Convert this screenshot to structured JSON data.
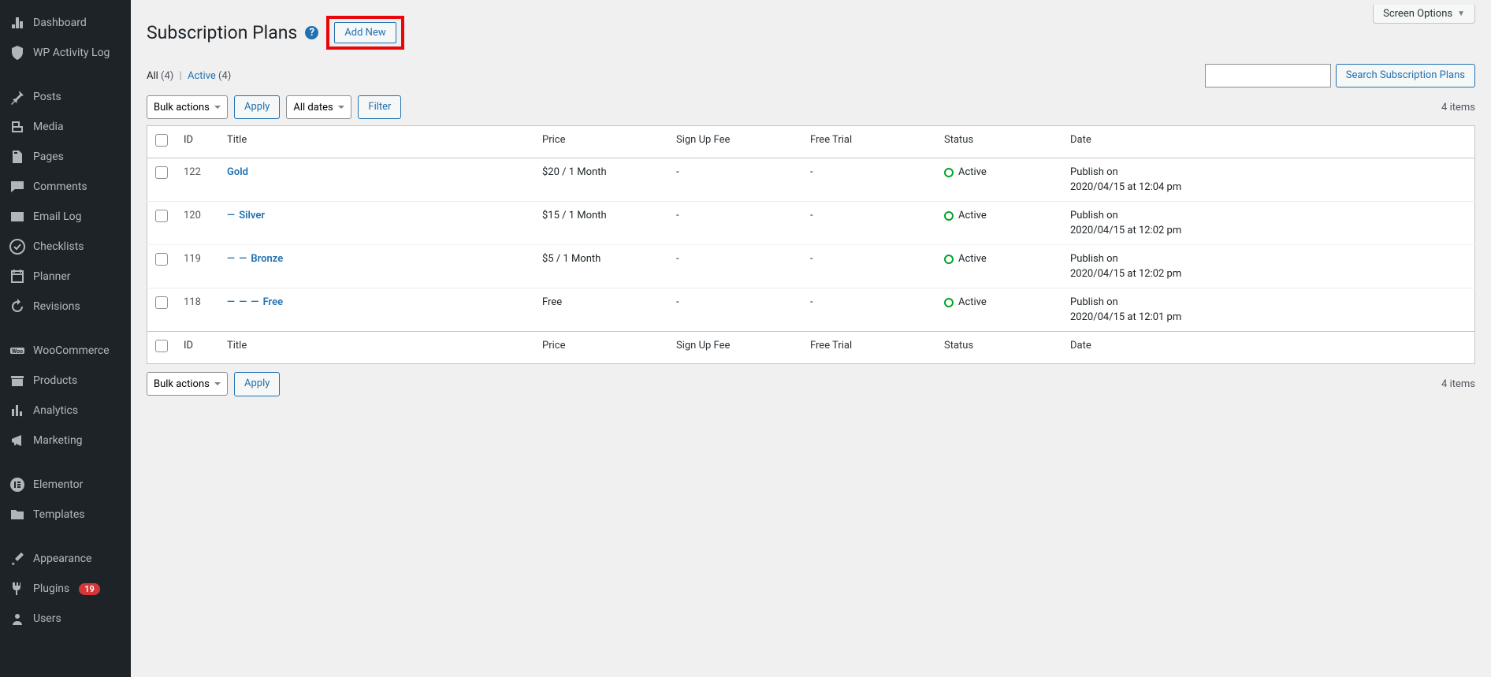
{
  "sidebar": {
    "items": [
      {
        "icon": "dashboard",
        "label": "Dashboard"
      },
      {
        "icon": "shield",
        "label": "WP Activity Log"
      },
      {
        "gap": true
      },
      {
        "icon": "pin",
        "label": "Posts"
      },
      {
        "icon": "media",
        "label": "Media"
      },
      {
        "icon": "pages",
        "label": "Pages"
      },
      {
        "icon": "comments",
        "label": "Comments"
      },
      {
        "icon": "mail",
        "label": "Email Log"
      },
      {
        "icon": "check",
        "label": "Checklists"
      },
      {
        "icon": "calendar",
        "label": "Planner"
      },
      {
        "icon": "history",
        "label": "Revisions"
      },
      {
        "gap": true
      },
      {
        "icon": "woo",
        "label": "WooCommerce"
      },
      {
        "icon": "products",
        "label": "Products"
      },
      {
        "icon": "analytics",
        "label": "Analytics"
      },
      {
        "icon": "megaphone",
        "label": "Marketing"
      },
      {
        "gap": true
      },
      {
        "icon": "elementor",
        "label": "Elementor"
      },
      {
        "icon": "folder",
        "label": "Templates"
      },
      {
        "gap": true
      },
      {
        "icon": "brush",
        "label": "Appearance"
      },
      {
        "icon": "plug",
        "label": "Plugins",
        "badge": "19"
      },
      {
        "icon": "users",
        "label": "Users"
      }
    ]
  },
  "header": {
    "screen_options": "Screen Options",
    "title": "Subscription Plans",
    "add_new": "Add New"
  },
  "filters": {
    "all": "All",
    "all_count": "(4)",
    "active": "Active",
    "active_count": "(4)"
  },
  "search": {
    "button": "Search Subscription Plans"
  },
  "bulk": {
    "label": "Bulk actions",
    "apply": "Apply"
  },
  "dates": {
    "label": "All dates",
    "filter": "Filter"
  },
  "item_count": "4 items",
  "table": {
    "headers": {
      "id": "ID",
      "title": "Title",
      "price": "Price",
      "signup": "Sign Up Fee",
      "trial": "Free Trial",
      "status": "Status",
      "date": "Date"
    },
    "rows": [
      {
        "id": "122",
        "prefix": "",
        "title": "Gold",
        "price": "$20 / 1 Month",
        "fee": "-",
        "trial": "-",
        "status": "Active",
        "date1": "Publish on",
        "date2": "2020/04/15 at 12:04 pm"
      },
      {
        "id": "120",
        "prefix": "— ",
        "title": "Silver",
        "price": "$15 / 1 Month",
        "fee": "-",
        "trial": "-",
        "status": "Active",
        "date1": "Publish on",
        "date2": "2020/04/15 at 12:02 pm"
      },
      {
        "id": "119",
        "prefix": "— — ",
        "title": "Bronze",
        "price": "$5 / 1 Month",
        "fee": "-",
        "trial": "-",
        "status": "Active",
        "date1": "Publish on",
        "date2": "2020/04/15 at 12:02 pm"
      },
      {
        "id": "118",
        "prefix": "— — — ",
        "title": "Free",
        "price": "Free",
        "fee": "-",
        "trial": "-",
        "status": "Active",
        "date1": "Publish on",
        "date2": "2020/04/15 at 12:01 pm"
      }
    ]
  }
}
